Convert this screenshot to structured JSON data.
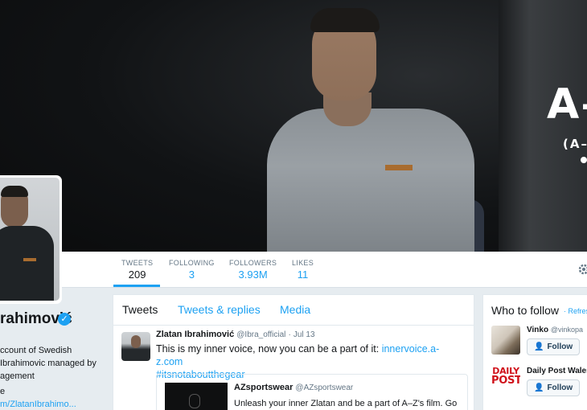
{
  "banner": {
    "text_main": "A–",
    "text_sub": "(A–"
  },
  "nav": {
    "stats": [
      {
        "label": "TWEETS",
        "value": "209"
      },
      {
        "label": "FOLLOWING",
        "value": "3"
      },
      {
        "label": "FOLLOWERS",
        "value": "3.93M"
      },
      {
        "label": "LIKES",
        "value": "11"
      }
    ],
    "active_stat": "TWEETS"
  },
  "profile": {
    "name": "rahimović",
    "bio": "ccount of Swedish Ibrahimovic managed by agement",
    "link_icon": "e",
    "link": "m/ZlatanIbrahimo..."
  },
  "timeline": {
    "tabs": [
      {
        "label": "Tweets"
      },
      {
        "label": "Tweets & replies"
      },
      {
        "label": "Media"
      }
    ],
    "active_tab": "Tweets",
    "tweet": {
      "name": "Zlatan Ibrahimović",
      "handle": "@Ibra_official",
      "separator": "·",
      "date": "Jul 13",
      "text": "This is my inner voice, now you can be a part of it:",
      "link": "innervoice.a-z.com",
      "hashtag": "#itsnotaboutthegear",
      "quote": {
        "name": "AZsportswear",
        "handle": "@AZsportswear",
        "text": "Unleash your inner Zlatan and be a part of A–Z's film. Go"
      }
    }
  },
  "who_to_follow": {
    "title": "Who to follow",
    "separator": "·",
    "refresh": "Refresh",
    "items": [
      {
        "name": "Vinko",
        "handle": "@vinkopa",
        "button": "Follow"
      },
      {
        "name": "Daily Post Wales",
        "handle": "",
        "button": "Follow",
        "logo_top": "DAILY",
        "logo_bottom": "POST"
      }
    ]
  },
  "colors": {
    "accent": "#1da1f2",
    "background": "#e6ecf0",
    "verified": "#1da1f2",
    "daily_post_red": "#d0121b"
  }
}
